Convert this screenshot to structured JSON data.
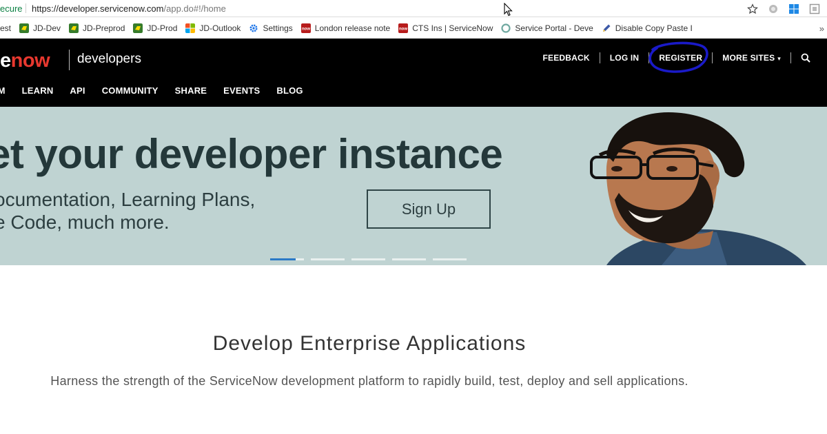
{
  "browser": {
    "secure_label": "ecure",
    "url_host": "https://developer.servicenow.com",
    "url_path": "/app.do#!/home",
    "icons": [
      "star-icon",
      "extension-icon",
      "windows-icon",
      "extension-icon"
    ]
  },
  "bookmarks": {
    "items": [
      {
        "label": "est",
        "icon": "none",
        "color": ""
      },
      {
        "label": "JD-Dev",
        "icon": "deere-icon",
        "color": "#367c2b"
      },
      {
        "label": "JD-Preprod",
        "icon": "deere-icon",
        "color": "#367c2b"
      },
      {
        "label": "JD-Prod",
        "icon": "deere-icon",
        "color": "#367c2b"
      },
      {
        "label": "JD-Outlook",
        "icon": "microsoft-icon",
        "color": "#f25022"
      },
      {
        "label": "Settings",
        "icon": "gear-icon",
        "color": "#1a73e8"
      },
      {
        "label": "London release note",
        "icon": "now-icon",
        "color": "#b71c1c"
      },
      {
        "label": "CTS Ins | ServiceNow",
        "icon": "now-icon",
        "color": "#b71c1c"
      },
      {
        "label": "Service Portal - Deve",
        "icon": "portal-icon",
        "color": "#6fa8a0"
      },
      {
        "label": "Disable Copy Paste I",
        "icon": "pen-icon",
        "color": "#3d5aa8"
      }
    ],
    "more": "»"
  },
  "header": {
    "logo_left": "e",
    "logo_now": "now",
    "brand": "developers",
    "top_links": {
      "feedback": "FEEDBACK",
      "login": "LOG IN",
      "register": "REGISTER",
      "more_sites": "MORE SITES",
      "caret": "▾"
    },
    "main_links": [
      "AM",
      "LEARN",
      "API",
      "COMMUNITY",
      "SHARE",
      "EVENTS",
      "BLOG"
    ]
  },
  "hero": {
    "title": "et your developer instance",
    "subtitle_line1": "ocumentation, Learning Plans,",
    "subtitle_line2": "e Code, much more.",
    "cta": "Sign Up",
    "carousel_count": 5,
    "active_slide": 1,
    "bg_color": "#bfd3d2"
  },
  "content": {
    "title": "Develop Enterprise Applications",
    "text": "Harness the strength of the ServiceNow development platform to rapidly build, test, deploy and sell applications."
  },
  "colors": {
    "accent": "#e8382f",
    "annotation": "#1a1ac8",
    "dark_text": "#24383a"
  }
}
